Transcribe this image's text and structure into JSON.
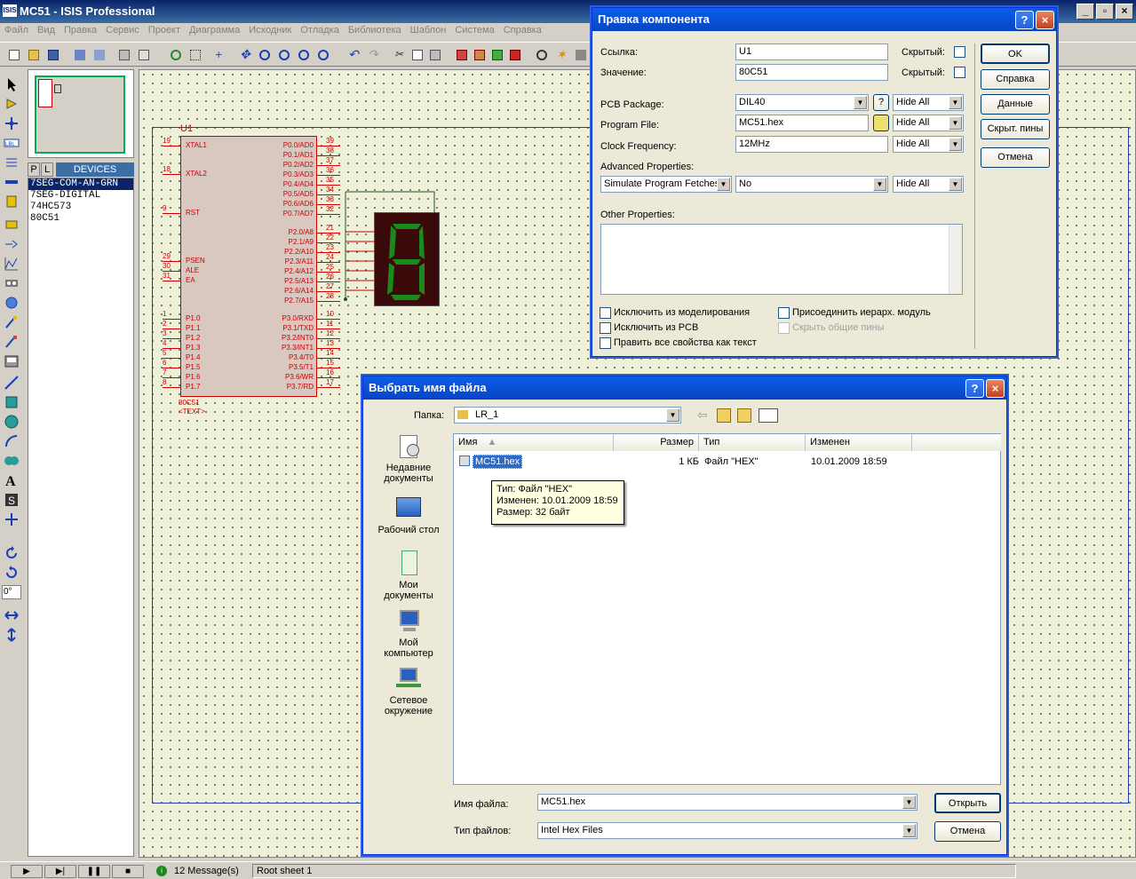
{
  "app": {
    "title": "MC51 - ISIS Professional",
    "icon_text": "ISIS"
  },
  "menu": [
    "Файл",
    "Вид",
    "Правка",
    "Сервис",
    "Проект",
    "Диаграмма",
    "Исходник",
    "Отладка",
    "Библиотека",
    "Шаблон",
    "Система",
    "Справка"
  ],
  "left_panel": {
    "tab_p": "P",
    "tab_l": "L",
    "devices_label": "DEVICES",
    "devices": [
      "7SEG-COM-AN-GRN",
      "7SEG-DIGITAL",
      "74HC573",
      "80C51"
    ],
    "rotation_value": "0°"
  },
  "schematic": {
    "ref": "U1",
    "part": "80C51",
    "text": "<TEXT>",
    "left_pins": [
      {
        "num": "19",
        "name": "XTAL1"
      },
      {
        "num": "18",
        "name": "XTAL2"
      },
      {
        "num": "9",
        "name": "RST"
      },
      {
        "num": "29",
        "name": "PSEN"
      },
      {
        "num": "30",
        "name": "ALE"
      },
      {
        "num": "31",
        "name": "EA"
      },
      {
        "num": "1",
        "name": "P1.0"
      },
      {
        "num": "2",
        "name": "P1.1"
      },
      {
        "num": "3",
        "name": "P1.2"
      },
      {
        "num": "4",
        "name": "P1.3"
      },
      {
        "num": "5",
        "name": "P1.4"
      },
      {
        "num": "6",
        "name": "P1.5"
      },
      {
        "num": "7",
        "name": "P1.6"
      },
      {
        "num": "8",
        "name": "P1.7"
      }
    ],
    "right_pins": [
      {
        "num": "39",
        "name": "P0.0/AD0"
      },
      {
        "num": "38",
        "name": "P0.1/AD1"
      },
      {
        "num": "37",
        "name": "P0.2/AD2"
      },
      {
        "num": "36",
        "name": "P0.3/AD3"
      },
      {
        "num": "35",
        "name": "P0.4/AD4"
      },
      {
        "num": "34",
        "name": "P0.5/AD5"
      },
      {
        "num": "33",
        "name": "P0.6/AD6"
      },
      {
        "num": "32",
        "name": "P0.7/AD7"
      },
      {
        "num": "21",
        "name": "P2.0/A8"
      },
      {
        "num": "22",
        "name": "P2.1/A9"
      },
      {
        "num": "23",
        "name": "P2.2/A10"
      },
      {
        "num": "24",
        "name": "P2.3/A11"
      },
      {
        "num": "25",
        "name": "P2.4/A12"
      },
      {
        "num": "26",
        "name": "P2.5/A13"
      },
      {
        "num": "27",
        "name": "P2.6/A14"
      },
      {
        "num": "28",
        "name": "P2.7/A15"
      },
      {
        "num": "10",
        "name": "P3.0/RXD"
      },
      {
        "num": "11",
        "name": "P3.1/TXD"
      },
      {
        "num": "12",
        "name": "P3.2/INT0"
      },
      {
        "num": "13",
        "name": "P3.3/INT1"
      },
      {
        "num": "14",
        "name": "P3.4/T0"
      },
      {
        "num": "15",
        "name": "P3.5/T1"
      },
      {
        "num": "16",
        "name": "P3.6/WR"
      },
      {
        "num": "17",
        "name": "P3.7/RD"
      }
    ],
    "display_digit": "8"
  },
  "component_dialog": {
    "title": "Правка компонента",
    "ref_label": "Ссылка:",
    "ref_value": "U1",
    "hidden_label": "Скрытый:",
    "value_label": "Значение:",
    "value_value": "80C51",
    "pcb_label": "PCB Package:",
    "pcb_value": "DIL40",
    "help_q": "?",
    "program_label": "Program File:",
    "program_value": "MC51.hex",
    "clock_label": "Clock Frequency:",
    "clock_value": "12MHz",
    "hide_all": "Hide All",
    "advanced_label": "Advanced Properties:",
    "advanced_prop": "Simulate Program Fetches",
    "advanced_value": "No",
    "other_label": "Other Properties:",
    "chk_exclude_sim": "Исключить из моделирования",
    "chk_exclude_pcb": "Исключить из PCB",
    "chk_edit_text": "Править все свойства как текст",
    "chk_attach": "Присоединить иерарх. модуль",
    "chk_hide_pins": "Скрыть общие пины",
    "btn_ok": "OK",
    "btn_help": "Справка",
    "btn_data": "Данные",
    "btn_hidden_pins": "Скрыт. пины",
    "btn_cancel": "Отмена"
  },
  "file_dialog": {
    "title": "Выбрать имя файла",
    "folder_label": "Папка:",
    "folder_value": "LR_1",
    "places": [
      "Недавние документы",
      "Рабочий стол",
      "Мои документы",
      "Мой компьютер",
      "Сетевое окружение"
    ],
    "columns": [
      "Имя",
      "Размер",
      "Тип",
      "Изменен"
    ],
    "files": [
      {
        "name": "MC51.hex",
        "size": "1 КБ",
        "type": "Файл \"HEX\"",
        "modified": "10.01.2009 18:59"
      }
    ],
    "tooltip": [
      "Тип: Файл \"HEX\"",
      "Изменен: 10.01.2009 18:59",
      "Размер: 32 байт"
    ],
    "filename_label": "Имя файла:",
    "filename_value": "MC51.hex",
    "filetype_label": "Тип файлов:",
    "filetype_value": "Intel Hex Files",
    "btn_open": "Открыть",
    "btn_cancel": "Отмена"
  },
  "status": {
    "messages": "12 Message(s)",
    "sheet": "Root sheet 1"
  },
  "colors": {
    "schematic_red": "#cc0000",
    "segment_green": "#1a8a1a",
    "canvas_bg": "#eef0d8"
  }
}
